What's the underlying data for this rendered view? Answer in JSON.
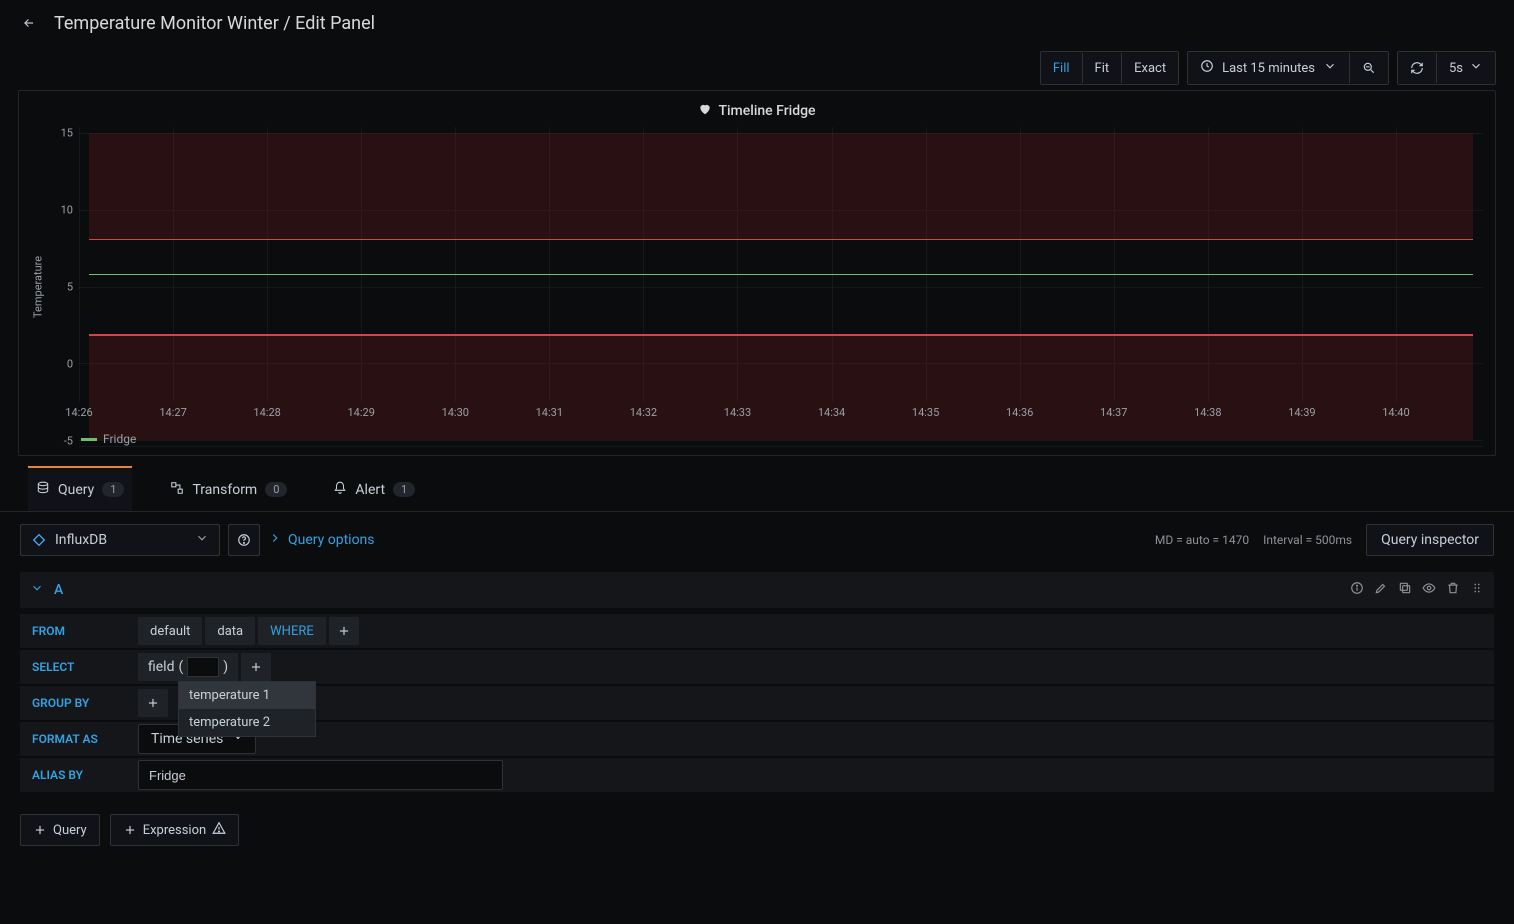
{
  "header": {
    "title": "Temperature Monitor Winter / Edit Panel"
  },
  "toolbar": {
    "view_modes": {
      "fill": "Fill",
      "fit": "Fit",
      "exact": "Exact"
    },
    "time_range": "Last 15 minutes",
    "refresh_interval": "5s"
  },
  "panel": {
    "title": "Timeline Fridge",
    "y_axis_label": "Temperature",
    "legend_series": "Fridge"
  },
  "chart_data": {
    "type": "line",
    "title": "Timeline Fridge",
    "xlabel": "",
    "ylabel": "Temperature",
    "ylim": [
      -5,
      15
    ],
    "y_ticks": [
      -5,
      0,
      5,
      10,
      15
    ],
    "x_ticks": [
      "14:26",
      "14:27",
      "14:28",
      "14:29",
      "14:30",
      "14:31",
      "14:32",
      "14:33",
      "14:34",
      "14:35",
      "14:36",
      "14:37",
      "14:38",
      "14:39",
      "14:40"
    ],
    "thresholds": [
      {
        "value": 8,
        "color": "#d64545"
      },
      {
        "value": 2,
        "color": "#d64545"
      }
    ],
    "zones": [
      {
        "from": 8,
        "to": 15,
        "color": "rgba(128,32,32,0.26)"
      },
      {
        "from": -5,
        "to": 2,
        "color": "rgba(128,32,32,0.26)"
      }
    ],
    "series": [
      {
        "name": "Fridge",
        "color": "#6fbf73",
        "x": [
          "14:26",
          "14:27",
          "14:28",
          "14:29",
          "14:30",
          "14:31",
          "14:32",
          "14:33",
          "14:34",
          "14:35",
          "14:36",
          "14:37",
          "14:38",
          "14:39",
          "14:40"
        ],
        "values": [
          5.8,
          5.8,
          5.8,
          5.8,
          5.8,
          5.9,
          5.9,
          5.9,
          5.9,
          5.9,
          5.9,
          5.9,
          5.9,
          5.9,
          5.9
        ]
      }
    ]
  },
  "tabs": {
    "query": {
      "label": "Query",
      "count": "1"
    },
    "transform": {
      "label": "Transform",
      "count": "0"
    },
    "alert": {
      "label": "Alert",
      "count": "1"
    }
  },
  "datasource": {
    "name": "InfluxDB"
  },
  "query_options_link": "Query options",
  "query_info": {
    "md": "MD = auto = 1470",
    "interval": "Interval = 500ms"
  },
  "inspector_label": "Query inspector",
  "query": {
    "name": "A",
    "labels": {
      "from": "FROM",
      "select": "SELECT",
      "group_by": "GROUP BY",
      "format_as": "FORMAT AS",
      "alias_by": "ALIAS BY"
    },
    "from": {
      "policy": "default",
      "measurement": "data",
      "where_kw": "WHERE"
    },
    "select": {
      "func": "field",
      "open": "(",
      "close": ")",
      "value": ""
    },
    "autocomplete": {
      "opt1": "temperature 1",
      "opt2": "temperature 2"
    },
    "format_as_value": "Time series",
    "alias_value": "Fridge"
  },
  "footer": {
    "add_query": "Query",
    "add_expression": "Expression"
  }
}
